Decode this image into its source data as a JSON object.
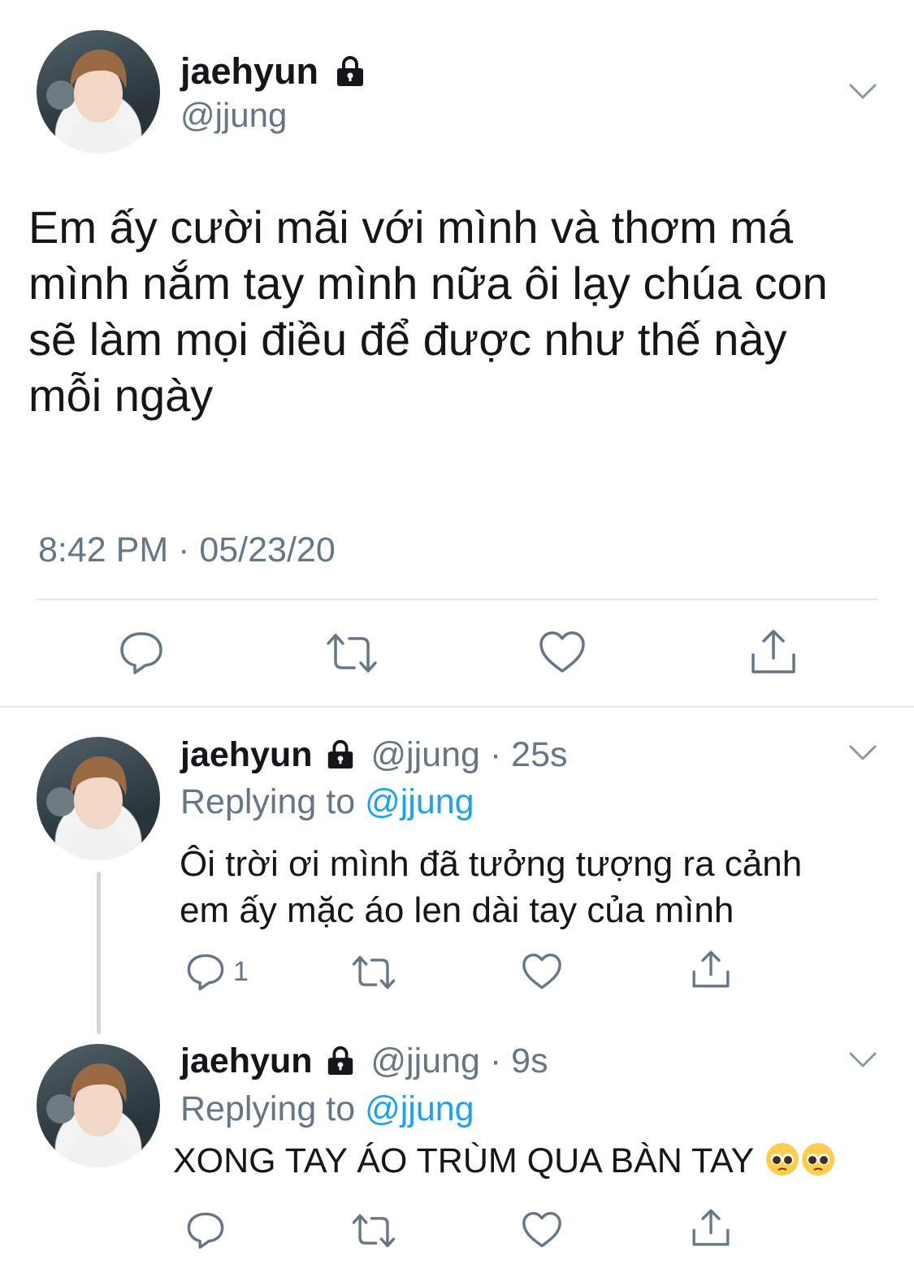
{
  "main_tweet": {
    "display_name": "jaehyun",
    "handle": "@jjung",
    "text_lines": [
      "Em ấy cười mãi với mình và thơm má",
      "mình nắm tay mình nữa ôi lạy chúa con",
      "sẽ làm mọi điều để được như thế này",
      "mỗi ngày"
    ],
    "timestamp": "8:42 PM · 05/23/20"
  },
  "reply1": {
    "display_name": "jaehyun",
    "handle": "@jjung",
    "separator": "·",
    "time": "25s",
    "replying_label": "Replying to",
    "replying_handle": "@jjung",
    "text_lines": [
      "Ôi trời ơi mình đã tưởng tượng ra cảnh",
      "em ấy mặc áo len dài tay của mình"
    ],
    "reply_count": "1"
  },
  "reply2": {
    "display_name": "jaehyun",
    "handle": "@jjung",
    "separator": "·",
    "time": "9s",
    "replying_label": "Replying to",
    "replying_handle": "@jjung",
    "text": "XONG TAY ÁO TRÙM QUA BÀN TAY"
  },
  "icons": [
    "lock-icon",
    "chevron-down-icon",
    "reply-icon",
    "retweet-icon",
    "like-icon",
    "share-icon",
    "pleading-face-emoji"
  ],
  "colors": {
    "link": "#1da1f2",
    "muted": "#657786",
    "text": "#14171a",
    "divider": "#e1e8ed"
  }
}
